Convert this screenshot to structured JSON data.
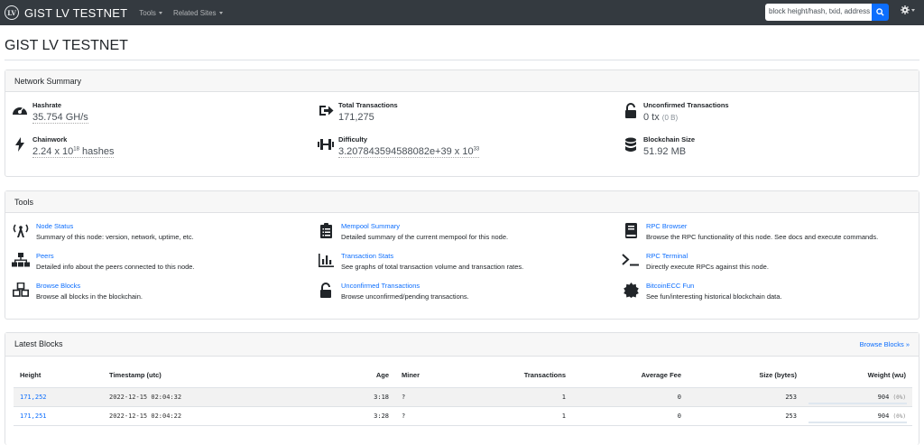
{
  "navbar": {
    "logo_text": "LV",
    "brand": "GIST LV TESTNET",
    "menu": [
      "Tools",
      "Related Sites"
    ],
    "search_placeholder": "block height/hash, txid, address"
  },
  "page_title": "GIST LV TESTNET",
  "network_summary": {
    "header": "Network Summary",
    "hashrate": {
      "label": "Hashrate",
      "value": "35.754 GH/s",
      "icon": "gauge-icon"
    },
    "chainwork": {
      "label": "Chainwork",
      "value_base": "2.24 x 10",
      "value_exp": "18",
      "value_suffix": " hashes",
      "icon": "bolt-icon"
    },
    "total_transactions": {
      "label": "Total Transactions",
      "value": "171,275",
      "icon": "share-arrow-icon"
    },
    "difficulty": {
      "label": "Difficulty",
      "value_base": "3.207843594588082e+39 x 10",
      "value_exp": "33",
      "icon": "dumbbell-icon"
    },
    "unconfirmed": {
      "label": "Unconfirmed Transactions",
      "value": "0 tx",
      "sub": "(0 B)",
      "icon": "unlock-icon"
    },
    "blockchain_size": {
      "label": "Blockchain Size",
      "value": "51.92 MB",
      "icon": "database-icon"
    }
  },
  "tools": {
    "header": "Tools",
    "items": [
      {
        "title": "Node Status",
        "desc": "Summary of this node: version, network, uptime, etc.",
        "icon": "broadcast-tower-icon"
      },
      {
        "title": "Peers",
        "desc": "Detailed info about the peers connected to this node.",
        "icon": "sitemap-icon"
      },
      {
        "title": "Browse Blocks",
        "desc": "Browse all blocks in the blockchain.",
        "icon": "cubes-icon"
      },
      {
        "title": "Mempool Summary",
        "desc": "Detailed summary of the current mempool for this node.",
        "icon": "clipboard-list-icon"
      },
      {
        "title": "Transaction Stats",
        "desc": "See graphs of total transaction volume and transaction rates.",
        "icon": "chart-bar-icon"
      },
      {
        "title": "Unconfirmed Transactions",
        "desc": "Browse unconfirmed/pending transactions.",
        "icon": "unlock-icon"
      },
      {
        "title": "RPC Browser",
        "desc": "Browse the RPC functionality of this node. See docs and execute commands.",
        "icon": "book-icon"
      },
      {
        "title": "RPC Terminal",
        "desc": "Directly execute RPCs against this node.",
        "icon": "terminal-icon"
      },
      {
        "title": "BitcoinECC Fun",
        "desc": "See fun/interesting historical blockchain data.",
        "icon": "certificate-icon"
      }
    ]
  },
  "latest_blocks": {
    "header": "Latest Blocks",
    "browse_link": "Browse Blocks »",
    "columns": [
      "Height",
      "Timestamp (utc)",
      "Age",
      "Miner",
      "Transactions",
      "Average Fee",
      "Size (bytes)",
      "Weight (wu)"
    ],
    "rows": [
      {
        "height": "171,252",
        "timestamp": "2022-12-15 02:04:32",
        "age": "3:18",
        "miner": "?",
        "transactions": "1",
        "avg_fee": "0",
        "size": "253",
        "weight": "904",
        "weight_pct": "(0%)"
      },
      {
        "height": "171,251",
        "timestamp": "2022-12-15 02:04:22",
        "age": "3:28",
        "miner": "?",
        "transactions": "1",
        "avg_fee": "0",
        "size": "253",
        "weight": "904",
        "weight_pct": "(0%)"
      }
    ]
  }
}
